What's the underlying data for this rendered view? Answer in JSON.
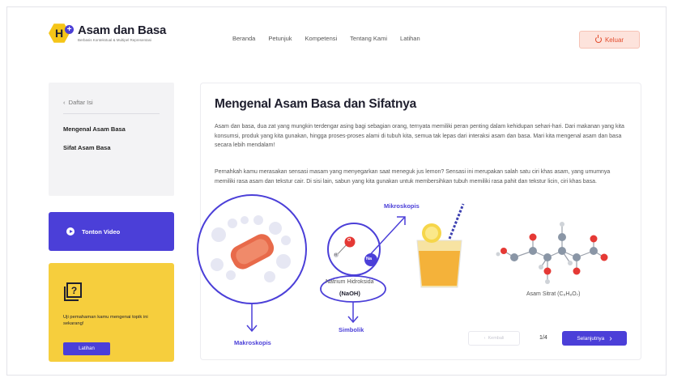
{
  "header": {
    "logo_letter": "H",
    "logo_plus": "+",
    "brand_title": "Asam dan Basa",
    "brand_subtitle": "Berbasis Kontekstual & Multipel Representasi",
    "nav": [
      "Beranda",
      "Petunjuk",
      "Kompetensi",
      "Tentang Kami",
      "Latihan"
    ],
    "logout_label": "Keluar",
    "logout_icon": "power-icon"
  },
  "sidebar": {
    "back_label": "Daftar Isi",
    "items": [
      "Mengenal Asam Basa",
      "Sifat Asam Basa"
    ],
    "video_label": "Tonton Video",
    "quiz_text": "Uji pemahaman kamu mengenai topik ini sekarang!",
    "quiz_button": "Latihan"
  },
  "main": {
    "title": "Mengenal Asam Basa dan Sifatnya",
    "paragraph1": "Asam dan basa, dua zat yang mungkin terdengar asing bagi sebagian orang, ternyata memiliki peran penting dalam kehidupan sehari-hari. Dari makanan yang kita konsumsi, produk yang kita gunakan, hingga proses-proses alami di tubuh kita, semua tak lepas dari interaksi asam dan basa. Mari kita  mengenal asam dan basa secara lebih mendalam!",
    "paragraph2": "Pernahkah kamu merasakan sensasi masam yang menyegarkan saat meneguk jus lemon? Sensasi ini merupakan salah satu ciri khas asam, yang umumnya memiliki rasa asam dan tekstur cair. Di sisi lain, sabun yang kita gunakan untuk membersihkan tubuh memiliki rasa pahit dan tekstur licin, ciri khas basa.",
    "label_mikroskopis": "Mikroskopis",
    "label_makroskopis": "Makroskopis",
    "label_simbolik": "Simbolik",
    "naoh_name": "Natrium Hidroksida",
    "naoh_formula": "(NaOH)",
    "citrat_label": "Asam Sitrat (C₆H₈O₇)",
    "atom_o": "O",
    "atom_h": "H",
    "atom_na": "Na",
    "pager_prev": "Kembali",
    "pager_page": "1/4",
    "pager_next": "Selanjutnya"
  },
  "colors": {
    "primary": "#4b3fd8",
    "yellow": "#f6ce3d",
    "logout_bg": "#fde3dc",
    "logout_text": "#e24b2c"
  }
}
